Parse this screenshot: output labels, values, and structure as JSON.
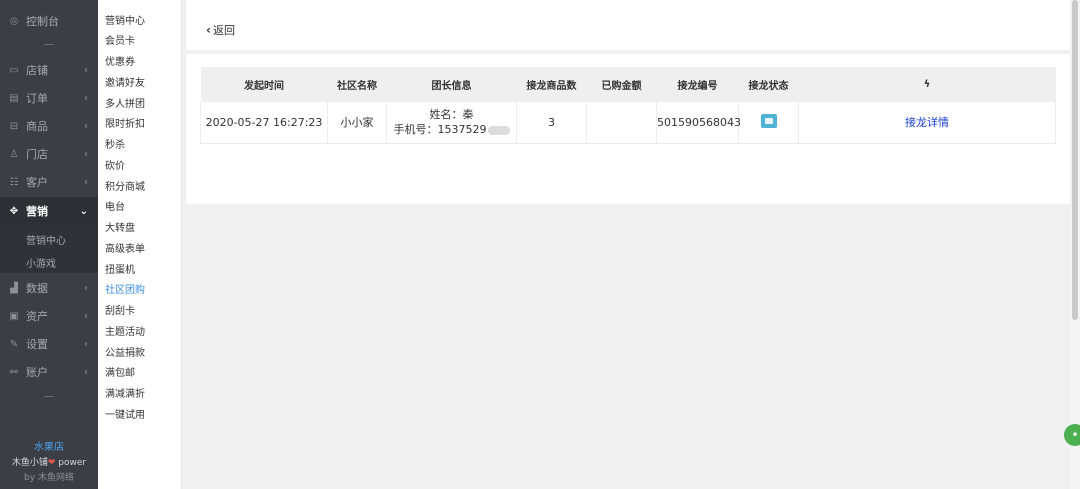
{
  "nav": {
    "items": [
      {
        "label": "控制台",
        "icon": "dashboard-icon",
        "glyph": "◎",
        "arrow": ""
      },
      {
        "label": "店铺",
        "icon": "shop-icon",
        "glyph": "▭",
        "arrow": "‹"
      },
      {
        "label": "订单",
        "icon": "order-icon",
        "glyph": "▤",
        "arrow": "‹"
      },
      {
        "label": "商品",
        "icon": "goods-icon",
        "glyph": "⊟",
        "arrow": "‹"
      },
      {
        "label": "门店",
        "icon": "store-icon",
        "glyph": "♙",
        "arrow": "‹"
      },
      {
        "label": "客户",
        "icon": "customer-icon",
        "glyph": "☷",
        "arrow": "‹"
      },
      {
        "label": "营销",
        "icon": "marketing-icon",
        "glyph": "✥",
        "arrow": "⌄"
      },
      {
        "label": "数据",
        "icon": "data-icon",
        "glyph": "▟",
        "arrow": "‹"
      },
      {
        "label": "资产",
        "icon": "asset-icon",
        "glyph": "▣",
        "arrow": "‹"
      },
      {
        "label": "设置",
        "icon": "settings-icon",
        "glyph": "✎",
        "arrow": "‹"
      },
      {
        "label": "账户",
        "icon": "account-icon",
        "glyph": "⚯",
        "arrow": "‹"
      }
    ],
    "sub": [
      "营销中心",
      "小游戏"
    ],
    "footer": {
      "shop": "水果店",
      "power_pre": "木鱼小铺",
      "heart": "❤",
      "power_post": " power",
      "by": "by 木鱼网络"
    }
  },
  "subnav": {
    "items": [
      "营销中心",
      "会员卡",
      "优惠券",
      "邀请好友",
      "多人拼团",
      "限时折扣",
      "秒杀",
      "砍价",
      "积分商城",
      "电台",
      "大转盘",
      "高级表单",
      "扭蛋机",
      "社区团购",
      "刮刮卡",
      "主题活动",
      "公益捐款",
      "满包邮",
      "满减满折",
      "一键试用"
    ],
    "active_index": 13
  },
  "topbar": {
    "back_label": "返回"
  },
  "table": {
    "headers": [
      "发起时间",
      "社区名称",
      "团长信息",
      "接龙商品数",
      "已购金额",
      "接龙编号",
      "接龙状态",
      "ϟ"
    ],
    "row": {
      "time": "2020-05-27 16:27:23",
      "community": "小小家",
      "leader_name": "姓名：秦",
      "leader_phone": "手机号：1537529",
      "goods_count": "3",
      "amount": "",
      "number": "501590568043",
      "status_icon": "status-icon",
      "action": "接龙详情"
    }
  },
  "colors": {
    "sidebar": "#3b3f45",
    "active_link": "#3a8ee6",
    "link": "#1a3fd6",
    "status": "#4fb3d6"
  }
}
